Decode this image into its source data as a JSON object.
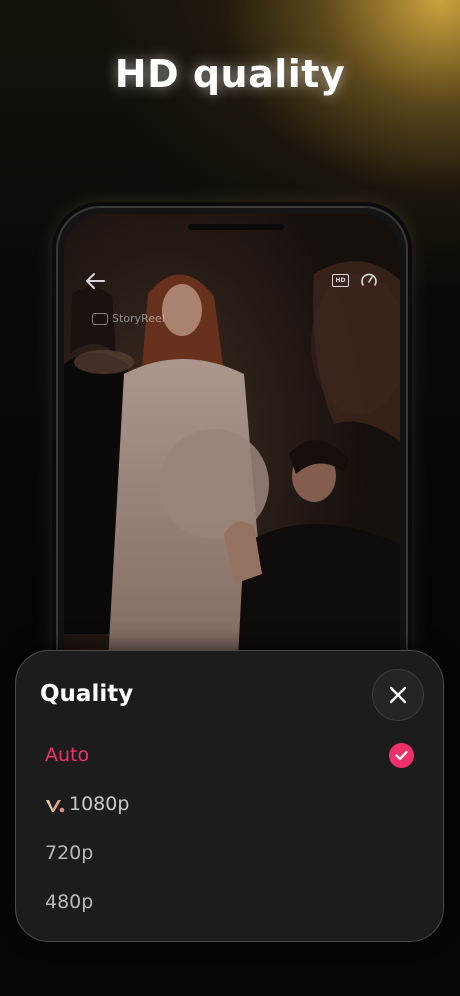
{
  "headline": "HD quality",
  "player": {
    "back_icon": "back-arrow-icon",
    "hd_badge_label": "HD",
    "speed_icon": "speed-gauge-icon",
    "watermark": "StoryReel"
  },
  "quality_sheet": {
    "title": "Quality",
    "close_icon": "close-icon",
    "accent_color": "#f0306a",
    "options": [
      {
        "label": "Auto",
        "selected": true
      },
      {
        "label": "1080p",
        "vip": true
      },
      {
        "label": "720p"
      },
      {
        "label": "480p"
      }
    ]
  }
}
